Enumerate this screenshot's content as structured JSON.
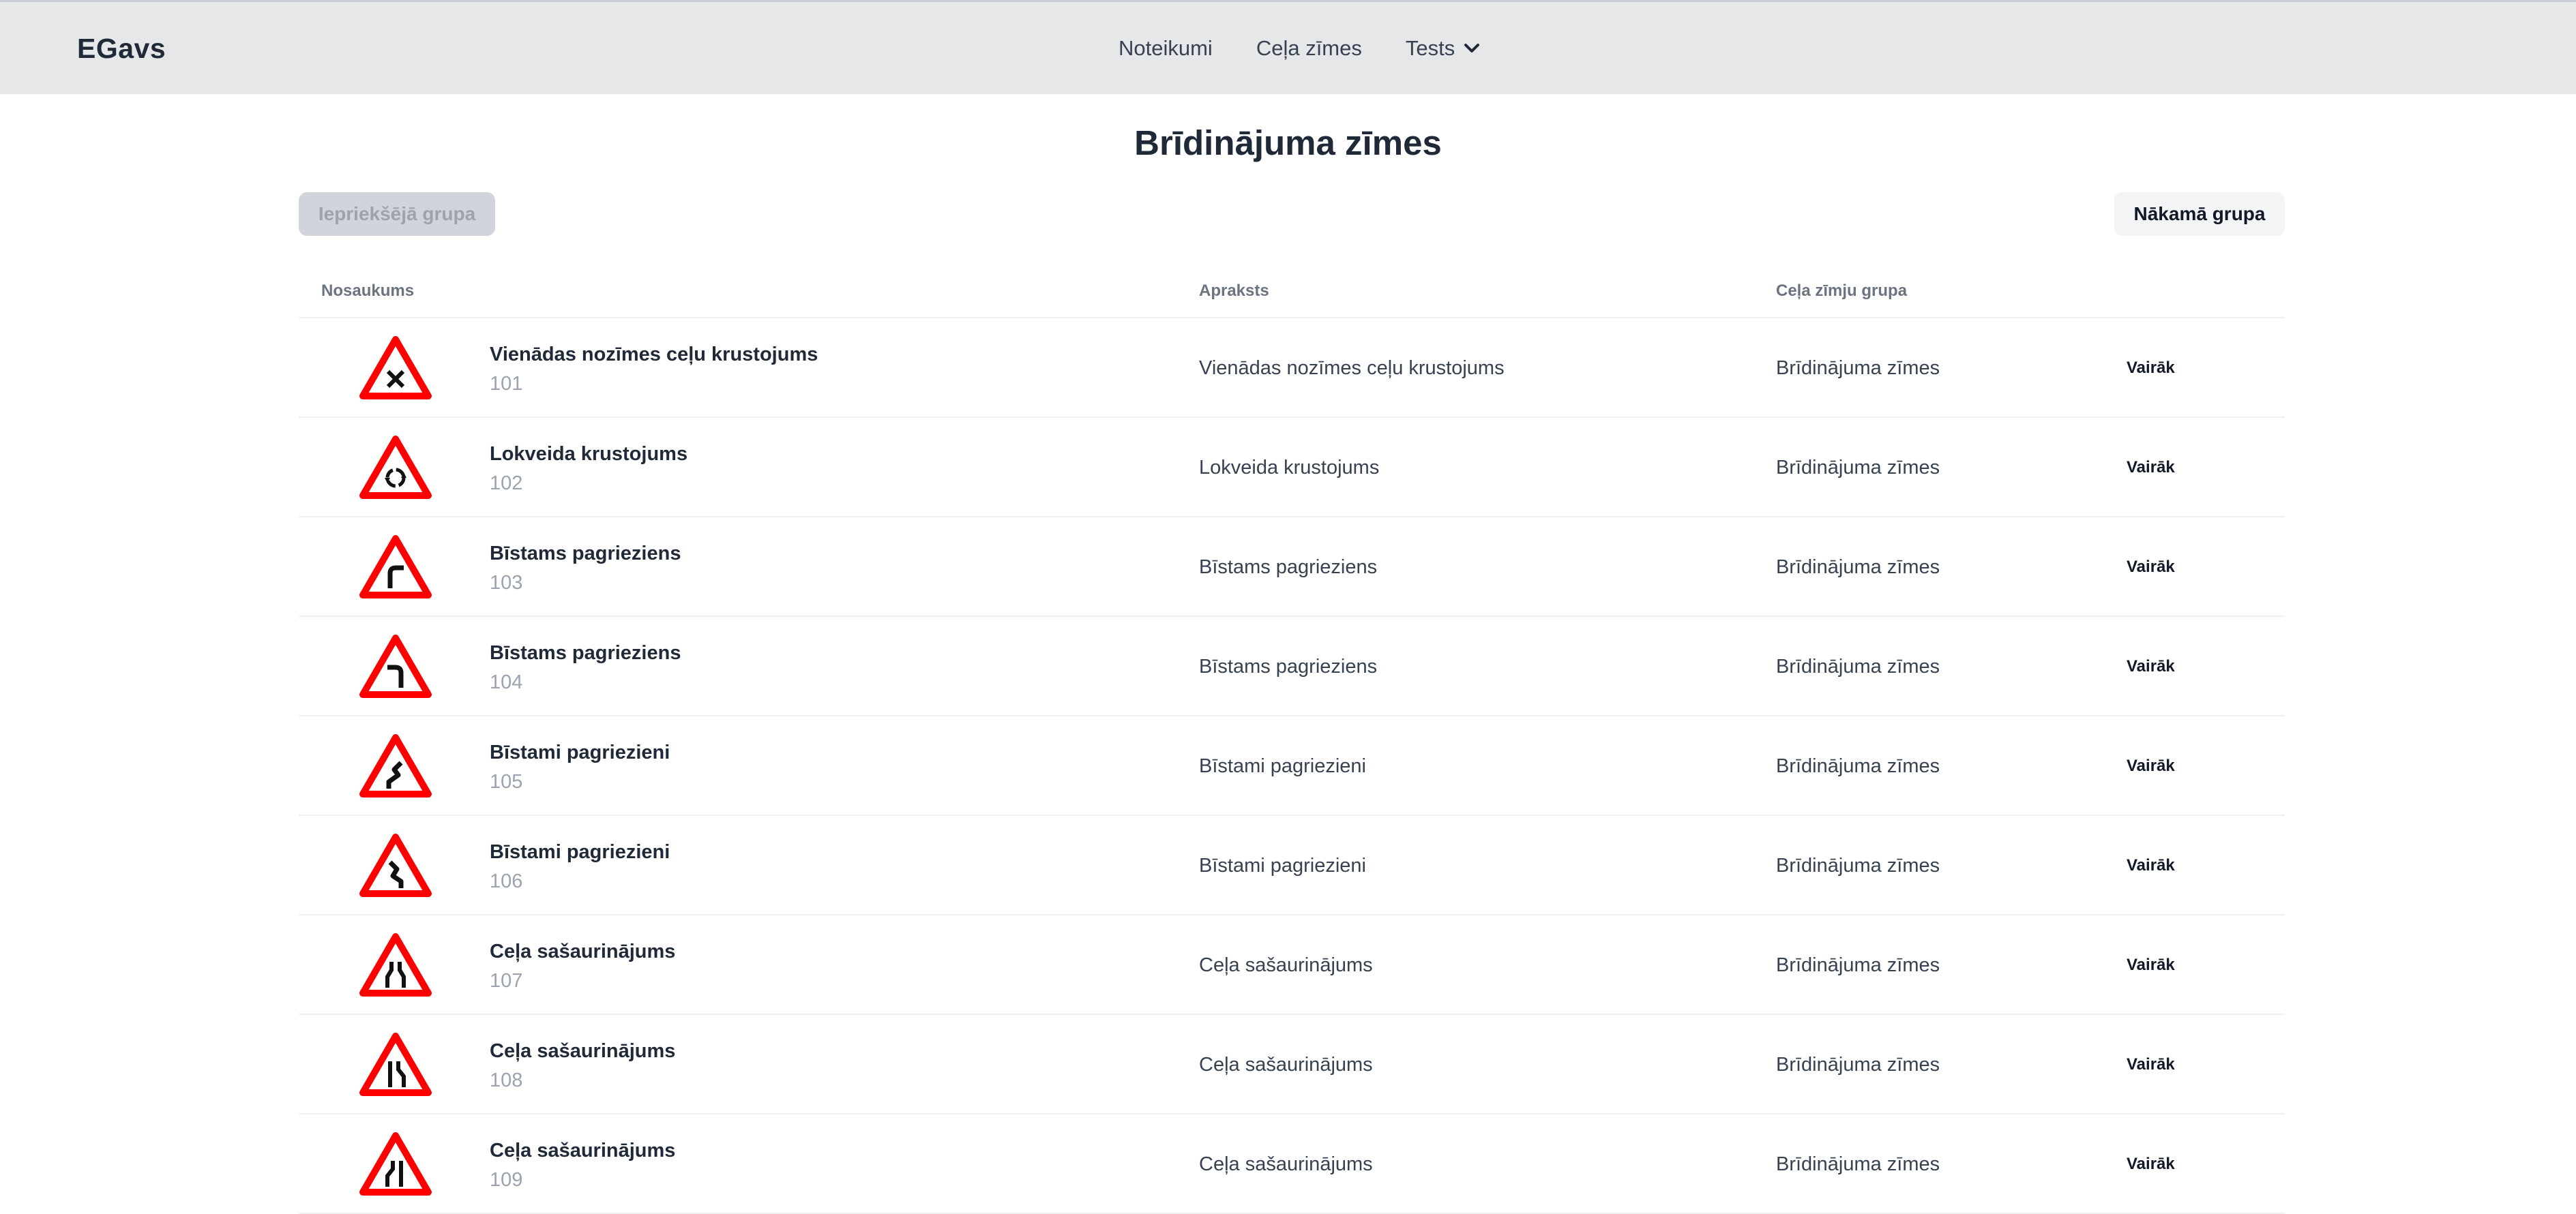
{
  "app": {
    "brand": "EGavs"
  },
  "nav": {
    "items": [
      {
        "label": "Noteikumi"
      },
      {
        "label": "Ceļa zīmes"
      },
      {
        "label": "Tests"
      }
    ]
  },
  "page": {
    "title": "Brīdinājuma zīmes",
    "prev_button": "Iepriekšējā grupa",
    "next_button": "Nākamā grupa"
  },
  "table": {
    "headers": [
      "Nosaukums",
      "Apraksts",
      "Ceļa zīmju grupa"
    ],
    "rows": [
      {
        "name": "Vienādas nozīmes ceļu krustojums",
        "code": "101",
        "desc": "Vienādas nozīmes ceļu krustojums",
        "group": "Brīdinājuma zīmes",
        "more": "Vairāk",
        "icon": "crossroads-sign-icon"
      },
      {
        "name": "Lokveida krustojums",
        "code": "102",
        "desc": "Lokveida krustojums",
        "group": "Brīdinājuma zīmes",
        "more": "Vairāk",
        "icon": "roundabout-sign-icon"
      },
      {
        "name": "Bīstams pagrieziens",
        "code": "103",
        "desc": "Bīstams pagrieziens",
        "group": "Brīdinājuma zīmes",
        "more": "Vairāk",
        "icon": "curve-right-sign-icon"
      },
      {
        "name": "Bīstams pagrieziens",
        "code": "104",
        "desc": "Bīstams pagrieziens",
        "group": "Brīdinājuma zīmes",
        "more": "Vairāk",
        "icon": "curve-left-sign-icon"
      },
      {
        "name": "Bīstami pagriezieni",
        "code": "105",
        "desc": "Bīstami pagriezieni",
        "group": "Brīdinājuma zīmes",
        "more": "Vairāk",
        "icon": "double-curve-right-sign-icon"
      },
      {
        "name": "Bīstami pagriezieni",
        "code": "106",
        "desc": "Bīstami pagriezieni",
        "group": "Brīdinājuma zīmes",
        "more": "Vairāk",
        "icon": "double-curve-left-sign-icon"
      },
      {
        "name": "Ceļa sašaurinājums",
        "code": "107",
        "desc": "Ceļa sašaurinājums",
        "group": "Brīdinājuma zīmes",
        "more": "Vairāk",
        "icon": "road-narrows-both-sign-icon"
      },
      {
        "name": "Ceļa sašaurinājums",
        "code": "108",
        "desc": "Ceļa sašaurinājums",
        "group": "Brīdinājuma zīmes",
        "more": "Vairāk",
        "icon": "road-narrows-right-sign-icon"
      },
      {
        "name": "Ceļa sašaurinājums",
        "code": "109",
        "desc": "Ceļa sašaurinājums",
        "group": "Brīdinājuma zīmes",
        "more": "Vairāk",
        "icon": "road-narrows-left-sign-icon"
      }
    ]
  },
  "colors": {
    "sign_red": "#ff0000",
    "navbar_bg": "#e5e7e8"
  }
}
